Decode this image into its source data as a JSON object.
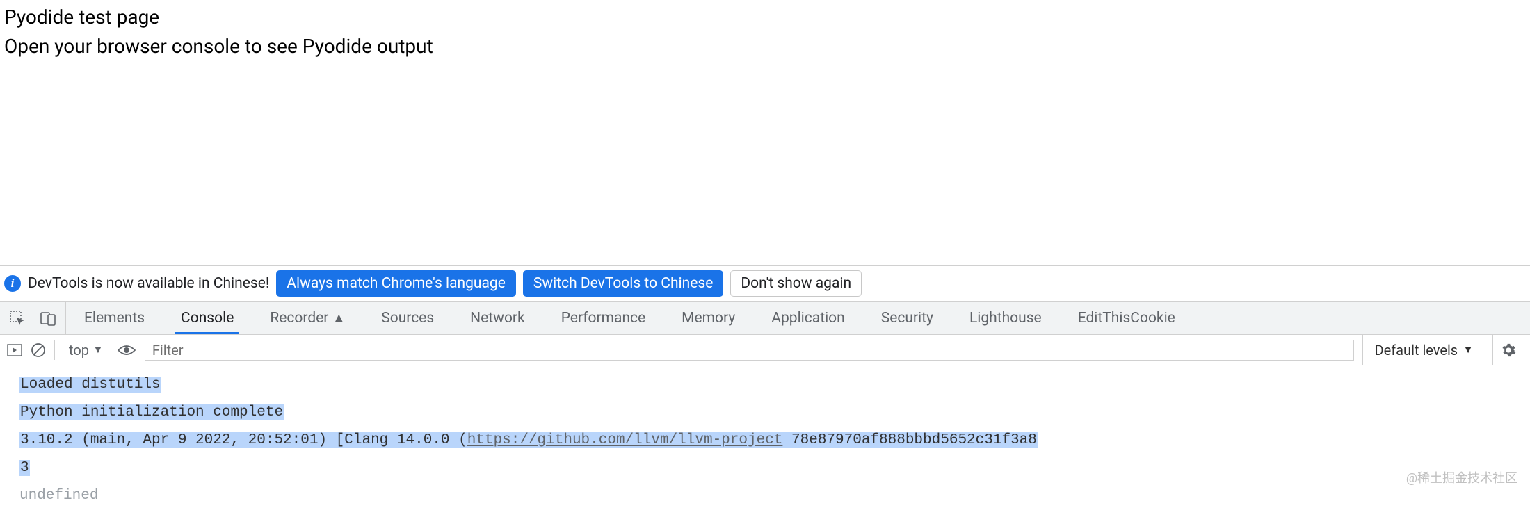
{
  "page": {
    "title": "Pyodide test page",
    "subtitle": "Open your browser console to see Pyodide output"
  },
  "infobar": {
    "message": "DevTools is now available in Chinese!",
    "always_match_label": "Always match Chrome's language",
    "switch_label": "Switch DevTools to Chinese",
    "dont_show_label": "Don't show again"
  },
  "tabs": {
    "elements": "Elements",
    "console": "Console",
    "recorder": "Recorder",
    "sources": "Sources",
    "network": "Network",
    "performance": "Performance",
    "memory": "Memory",
    "application": "Application",
    "security": "Security",
    "lighthouse": "Lighthouse",
    "edit_this_cookie": "EditThisCookie"
  },
  "toolbar": {
    "context": "top",
    "filter_placeholder": "Filter",
    "levels": "Default levels"
  },
  "console": {
    "lines": {
      "l1": "Loaded distutils",
      "l2": "Python initialization complete",
      "l3_pre": "3.10.2 (main, Apr  9 2022, 20:52:01) [Clang 14.0.0 (",
      "l3_link": "https://github.com/llvm/llvm-project",
      "l3_post": " 78e87970af888bbbd5652c31f3a8",
      "l4": "3",
      "l5": "undefined"
    }
  },
  "watermark": "@稀土掘金技术社区"
}
